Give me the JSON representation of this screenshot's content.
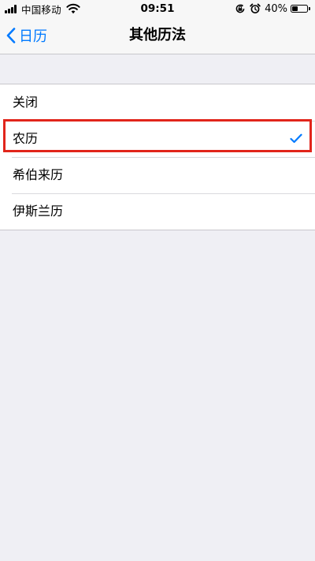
{
  "status_bar": {
    "carrier": "中国移动",
    "time": "09:51",
    "battery_percent": "40%",
    "battery_level": 0.4,
    "icons": [
      "signal-icon",
      "wifi-icon",
      "orientation-lock-icon",
      "alarm-icon",
      "battery-icon"
    ]
  },
  "nav": {
    "back_label": "日历",
    "title": "其他历法"
  },
  "calendar_options": [
    {
      "label": "关闭",
      "selected": false
    },
    {
      "label": "农历",
      "selected": true
    },
    {
      "label": "希伯来历",
      "selected": false
    },
    {
      "label": "伊斯兰历",
      "selected": false
    }
  ],
  "colors": {
    "accent": "#007aff",
    "highlight": "#e1251b",
    "background": "#efeff4"
  }
}
